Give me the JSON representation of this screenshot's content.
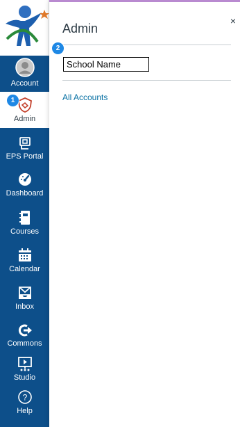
{
  "nav": {
    "items": [
      {
        "label": "Account",
        "icon": "account-avatar-icon"
      },
      {
        "label": "Admin",
        "icon": "shield-icon",
        "badge": "1"
      },
      {
        "label": "EPS Portal",
        "icon": "portal-icon"
      },
      {
        "label": "Dashboard",
        "icon": "dashboard-gauge-icon"
      },
      {
        "label": "Courses",
        "icon": "courses-notebook-icon"
      },
      {
        "label": "Calendar",
        "icon": "calendar-icon"
      },
      {
        "label": "Inbox",
        "icon": "inbox-icon"
      },
      {
        "label": "Commons",
        "icon": "commons-arrow-icon"
      },
      {
        "label": "Studio",
        "icon": "studio-screen-icon"
      },
      {
        "label": "Help",
        "icon": "help-circle-icon"
      }
    ]
  },
  "tray": {
    "title": "Admin",
    "close_glyph": "×",
    "badge": "2",
    "school_field_value": "School Name",
    "links": [
      {
        "label": "All Accounts"
      }
    ]
  },
  "colors": {
    "nav_bg": "#0d4f8a",
    "active_icon": "#c3412c",
    "link": "#0770a3",
    "badge": "#1e88e5"
  }
}
